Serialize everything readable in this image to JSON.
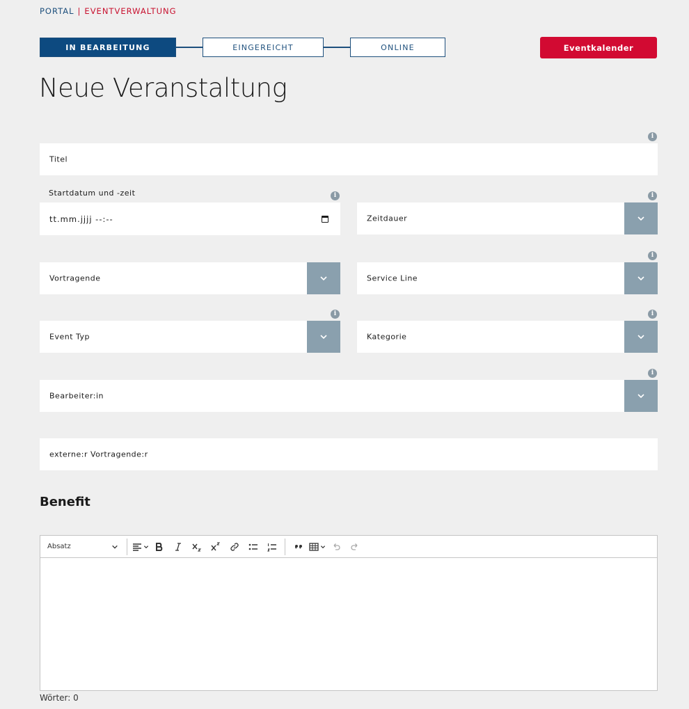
{
  "breadcrumb": {
    "portal": "PORTAL",
    "separator": "|",
    "current": "EVENTVERWALTUNG"
  },
  "stepper": {
    "steps": [
      {
        "label": "IN BEARBEITUNG",
        "active": true
      },
      {
        "label": "EINGEREICHT",
        "active": false
      },
      {
        "label": "ONLINE",
        "active": false
      }
    ]
  },
  "header": {
    "calendar_button": "Eventkalender"
  },
  "page_title": "Neue Veranstaltung",
  "form": {
    "titel": {
      "label": "Titel"
    },
    "startdatum": {
      "label": "Startdatum und -zeit",
      "value": "tt.mm.jjjj --:--"
    },
    "zeitdauer": {
      "label": "Zeitdauer"
    },
    "vortragende": {
      "label": "Vortragende"
    },
    "service_line": {
      "label": "Service Line"
    },
    "event_typ": {
      "label": "Event Typ"
    },
    "kategorie": {
      "label": "Kategorie"
    },
    "bearbeiter": {
      "label": "Bearbeiter:in"
    },
    "externe": {
      "label": "externe:r Vortragende:r"
    },
    "info_icon_glyph": "i"
  },
  "benefit": {
    "title": "Benefit",
    "toolbar": {
      "paragraph_select": "Absatz"
    },
    "word_count": "Wörter: 0"
  },
  "colors": {
    "primary_blue": "#0d4a80",
    "accent_red": "#d20a32",
    "dropdown_gray": "#8aa0ae",
    "background": "#efefef"
  }
}
